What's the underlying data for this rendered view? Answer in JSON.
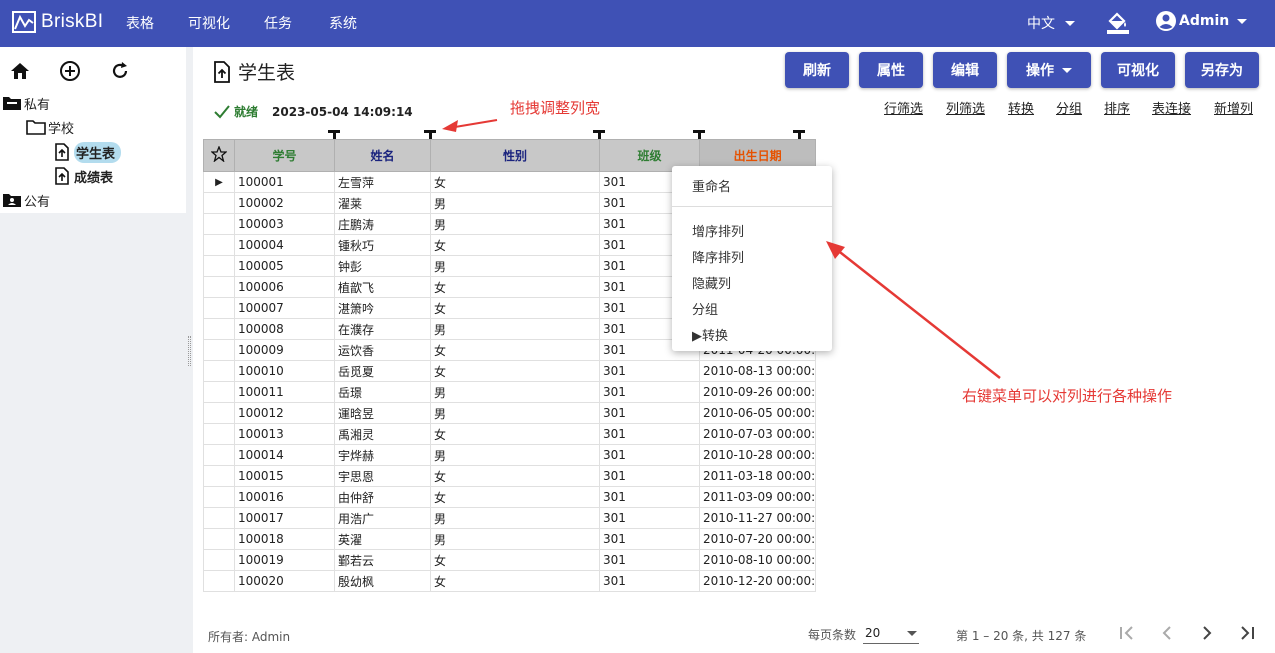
{
  "app": {
    "title": "BriskBI"
  },
  "nav": [
    {
      "label": "表格"
    },
    {
      "label": "可视化"
    },
    {
      "label": "任务"
    },
    {
      "label": "系统"
    }
  ],
  "header": {
    "language": "中文",
    "user": "Admin"
  },
  "sidebar": {
    "tools": [
      "home-icon",
      "add-circle-icon",
      "refresh-icon"
    ],
    "tree": [
      {
        "label": "私有"
      },
      {
        "label": "学校"
      },
      {
        "label": "学生表"
      },
      {
        "label": "成绩表"
      },
      {
        "label": "公有"
      }
    ]
  },
  "page": {
    "title": "学生表"
  },
  "toolbar": {
    "buttons": [
      {
        "label": "刷新"
      },
      {
        "label": "属性"
      },
      {
        "label": "编辑"
      },
      {
        "label": "操作"
      },
      {
        "label": "可视化"
      },
      {
        "label": "另存为"
      }
    ]
  },
  "status": {
    "text": "就绪",
    "timestamp": "2023-05-04 14:09:14"
  },
  "table_links": [
    "行筛选",
    "列筛选",
    "转换",
    "分组",
    "排序",
    "表连接",
    "新增列"
  ],
  "annotations": {
    "drag_hint": "拖拽调整列宽",
    "menu_hint": "右键菜单可以对列进行各种操作"
  },
  "colors": {
    "primary": "#3f51b5",
    "annotation": "#e53935",
    "ok": "#2e7d32"
  },
  "table": {
    "columns": [
      {
        "label": "学号",
        "color": "#2e7d32"
      },
      {
        "label": "姓名",
        "color": "#1a237e"
      },
      {
        "label": "性别",
        "color": "#1a237e"
      },
      {
        "label": "班级",
        "color": "#2e7d32"
      },
      {
        "label": "出生日期",
        "color": "#e65100"
      }
    ],
    "rows": [
      [
        "100001",
        "左雪萍",
        "女",
        "301",
        ""
      ],
      [
        "100002",
        "濯莱",
        "男",
        "301",
        ""
      ],
      [
        "100003",
        "庄鹏涛",
        "男",
        "301",
        ""
      ],
      [
        "100004",
        "锺秋巧",
        "女",
        "301",
        ""
      ],
      [
        "100005",
        "钟彭",
        "男",
        "301",
        ""
      ],
      [
        "100006",
        "植歆飞",
        "女",
        "301",
        ""
      ],
      [
        "100007",
        "湛箫吟",
        "女",
        "301",
        ""
      ],
      [
        "100008",
        "在濮存",
        "男",
        "301",
        ""
      ],
      [
        "100009",
        "运饮香",
        "女",
        "301",
        "2011-04-20 00:00:"
      ],
      [
        "100010",
        "岳觅夏",
        "女",
        "301",
        "2010-08-13 00:00:"
      ],
      [
        "100011",
        "岳璟",
        "男",
        "301",
        "2010-09-26 00:00:"
      ],
      [
        "100012",
        "運晗昱",
        "男",
        "301",
        "2010-06-05 00:00:"
      ],
      [
        "100013",
        "禹湘灵",
        "女",
        "301",
        "2010-07-03 00:00:"
      ],
      [
        "100014",
        "宇烨赫",
        "男",
        "301",
        "2010-10-28 00:00:"
      ],
      [
        "100015",
        "宇思恩",
        "女",
        "301",
        "2011-03-18 00:00:"
      ],
      [
        "100016",
        "由仲舒",
        "女",
        "301",
        "2011-03-09 00:00:"
      ],
      [
        "100017",
        "用浩广",
        "男",
        "301",
        "2010-11-27 00:00:"
      ],
      [
        "100018",
        "英濯",
        "男",
        "301",
        "2010-07-20 00:00:"
      ],
      [
        "100019",
        "鄞若云",
        "女",
        "301",
        "2010-08-10 00:00:"
      ],
      [
        "100020",
        "殷幼枫",
        "女",
        "301",
        "2010-12-20 00:00:"
      ]
    ]
  },
  "context_menu": {
    "items": [
      "重命名",
      "增序排列",
      "降序排列",
      "隐藏列",
      "分组",
      "▶转换"
    ]
  },
  "footer": {
    "owner": "所有者: Admin",
    "per_page_label": "每页条数",
    "per_page": "20",
    "range": "第 1 – 20 条, 共 127 条"
  }
}
